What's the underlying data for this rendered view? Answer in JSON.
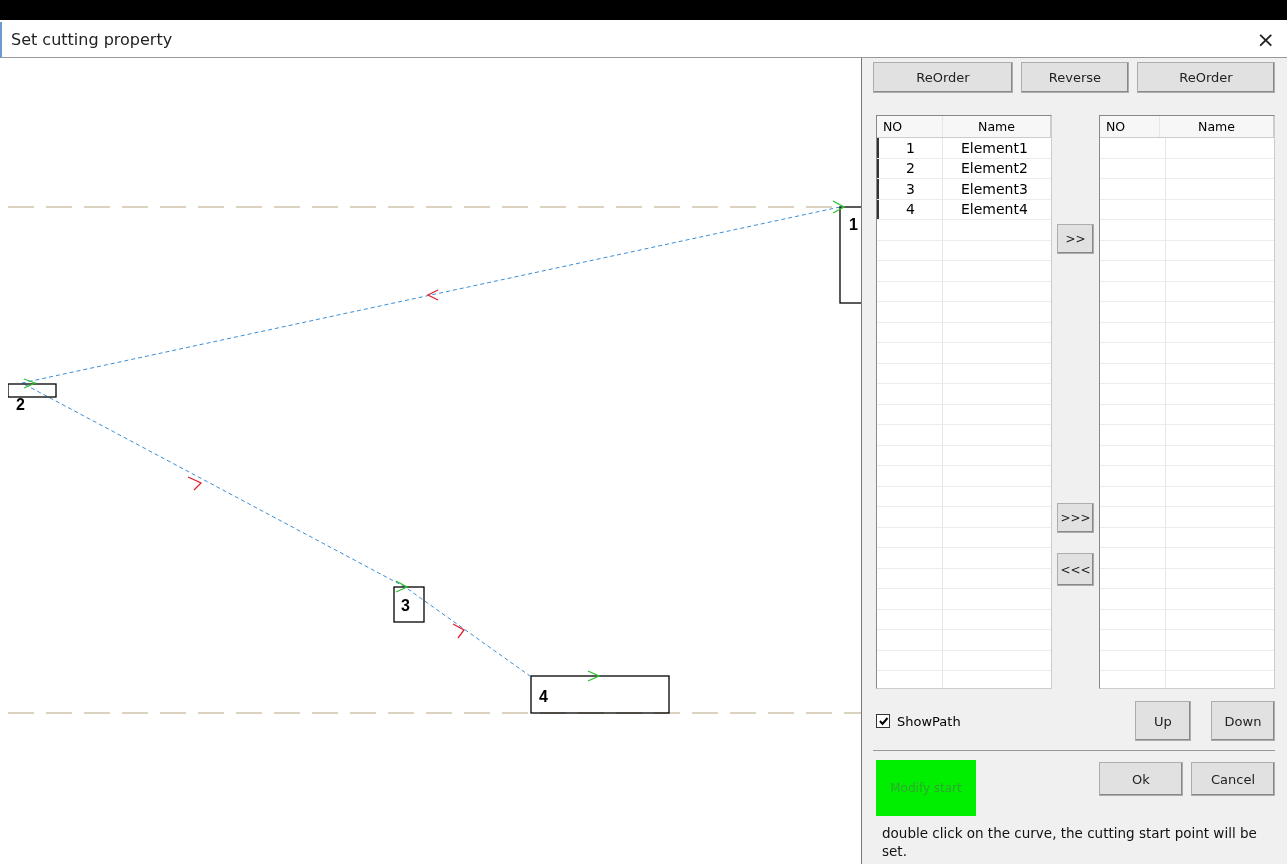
{
  "window": {
    "title": "Set cutting property",
    "close": "×"
  },
  "canvas": {
    "elements": [
      {
        "label": "1"
      },
      {
        "label": "2"
      },
      {
        "label": "3"
      },
      {
        "label": "4"
      }
    ]
  },
  "top_buttons": [
    "ReOrder",
    "Reverse",
    "ReOrder"
  ],
  "left_list": {
    "columns": [
      "NO",
      "Name"
    ],
    "rows": [
      {
        "no": "1",
        "name": "Element1"
      },
      {
        "no": "2",
        "name": "Element2"
      },
      {
        "no": "3",
        "name": "Element3"
      },
      {
        "no": "4",
        "name": "Element4"
      }
    ]
  },
  "move_buttons": [
    ">>",
    ">>>",
    "<<<"
  ],
  "right_list": {
    "columns": [
      "NO",
      "Name"
    ]
  },
  "show_path": {
    "label": "ShowPath",
    "checked": true
  },
  "order_buttons": [
    "Up",
    "Down"
  ],
  "modify_start": {
    "label": "Modify start"
  },
  "dialog_buttons": [
    "Ok",
    "Cancel"
  ],
  "hint": "double click on the curve, the cutting start point will be set."
}
